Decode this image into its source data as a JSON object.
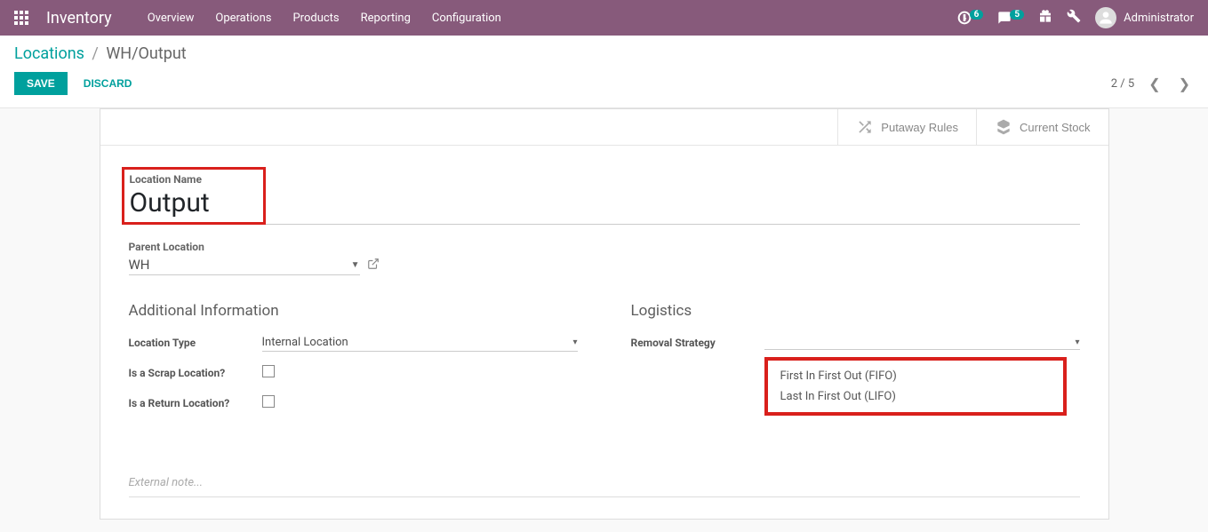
{
  "navbar": {
    "app_name": "Inventory",
    "menu": [
      "Overview",
      "Operations",
      "Products",
      "Reporting",
      "Configuration"
    ],
    "badge_clock": "6",
    "badge_chat": "5",
    "user_name": "Administrator"
  },
  "breadcrumb": {
    "root": "Locations",
    "current": "WH/Output"
  },
  "actions": {
    "save": "SAVE",
    "discard": "DISCARD"
  },
  "pager": {
    "text": "2 / 5"
  },
  "stat_buttons": {
    "putaway": "Putaway Rules",
    "stock": "Current Stock"
  },
  "form": {
    "location_name_label": "Location Name",
    "location_name_value": "Output",
    "parent_location_label": "Parent Location",
    "parent_location_value": "WH",
    "section_additional": "Additional Information",
    "location_type_label": "Location Type",
    "location_type_value": "Internal Location",
    "scrap_label": "Is a Scrap Location?",
    "return_label": "Is a Return Location?",
    "section_logistics": "Logistics",
    "removal_strategy_label": "Removal Strategy",
    "note_placeholder": "External note..."
  },
  "dropdown": {
    "options": [
      "First In First Out (FIFO)",
      "Last In First Out (LIFO)"
    ]
  }
}
